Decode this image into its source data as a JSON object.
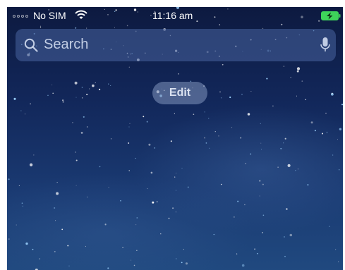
{
  "status_bar": {
    "carrier": "No SIM",
    "time": "11:16 am",
    "wifi_icon": "wifi-icon",
    "battery_icon": "battery-charging-icon",
    "battery_color": "#3ed35a"
  },
  "search": {
    "placeholder": "Search",
    "search_icon": "search-icon",
    "mic_icon": "microphone-icon"
  },
  "widgets": {
    "edit_label": "Edit"
  },
  "colors": {
    "background_top": "#0d1a40",
    "background_bottom": "#20497f"
  }
}
